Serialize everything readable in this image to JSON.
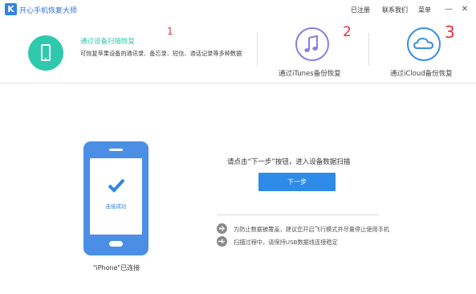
{
  "app": {
    "logo_letter": "K",
    "title": "开心手机恢复大师"
  },
  "titlebar": {
    "registered": "已注册",
    "contact": "联系我们",
    "menu": "菜单",
    "minimize_glyph": "—",
    "close_glyph": "✕"
  },
  "modes": [
    {
      "title": "通过设备扫描恢复",
      "desc": "可恢复苹果设备的通讯录、备忘录、短信、通话记录等多种数据",
      "annotation": "1",
      "icon": "phone-icon",
      "color": "#2fc9ad"
    },
    {
      "title": "通过iTunes备份恢复",
      "annotation": "2",
      "icon": "music-note-icon",
      "color": "#8e7ce0"
    },
    {
      "title": "通过iCloud备份恢复",
      "annotation": "3",
      "icon": "cloud-icon",
      "color": "#3b8ee8"
    }
  ],
  "device": {
    "status": "连接成功",
    "caption": "\"iPhone\"已连接"
  },
  "main": {
    "prompt": "请点击“下一步”按钮，进入设备数据扫描",
    "next_label": "下一步",
    "accent": "#2f8be8"
  },
  "tips": [
    {
      "icon": "airplane-icon",
      "text": "为防止数据被覆盖，建议您开启飞行模式并尽量停止使用手机"
    },
    {
      "icon": "usb-icon",
      "text": "扫描过程中，请保持USB数据线连接稳定"
    }
  ],
  "annotation_color": "#e8303a"
}
